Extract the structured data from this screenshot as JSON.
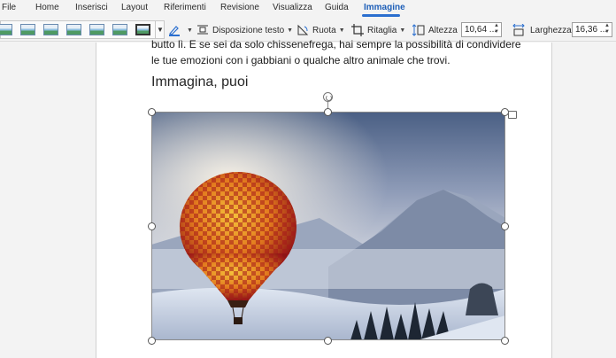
{
  "menu": {
    "tabs": [
      "File",
      "Home",
      "Inserisci",
      "Layout",
      "Riferimenti",
      "Revisione",
      "Visualizza",
      "Guida",
      "Immagine"
    ],
    "active_tab": "Immagine"
  },
  "ribbon": {
    "wrap_text": "Disposizione testo",
    "rotate": "Ruota",
    "crop": "Ritaglia",
    "height_label": "Altezza",
    "height_value": "10,64 ...",
    "width_label": "Larghezza",
    "width_value": "16,36 ..."
  },
  "document": {
    "line1": "butto lì. E se sei da solo chissenefrega, hai sempre la possibilità di condividere",
    "line2": "le tue emozioni con i gabbiani o qualche altro animale che trovi.",
    "heading": "Immagina, puoi"
  },
  "image": {
    "subject": "hot-air-balloon-over-snowy-mountains"
  },
  "colors": {
    "accent": "#2b6fcf",
    "page": "#ffffff",
    "background": "#f3f3f3"
  }
}
